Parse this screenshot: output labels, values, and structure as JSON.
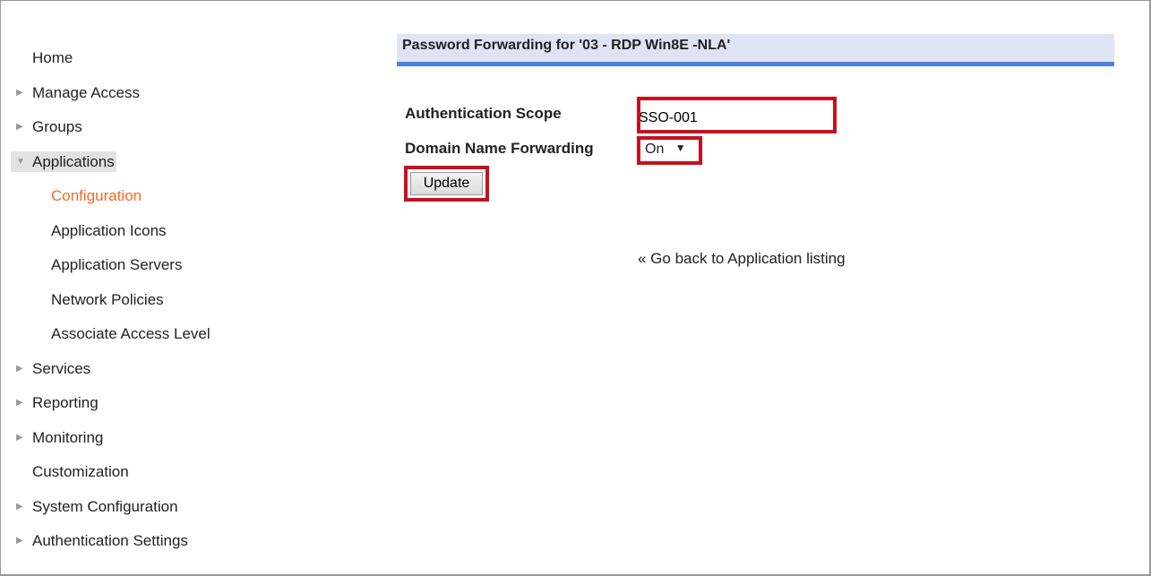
{
  "sidebar": {
    "items": [
      {
        "label": "Home",
        "arrow": ""
      },
      {
        "label": "Manage Access",
        "arrow": "▶"
      },
      {
        "label": "Groups",
        "arrow": "▶"
      },
      {
        "label": "Applications",
        "arrow": "▼"
      },
      {
        "label": "Configuration",
        "arrow": ""
      },
      {
        "label": "Application Icons",
        "arrow": ""
      },
      {
        "label": "Application Servers",
        "arrow": ""
      },
      {
        "label": "Network Policies",
        "arrow": ""
      },
      {
        "label": "Associate Access Level",
        "arrow": ""
      },
      {
        "label": "Services",
        "arrow": "▶"
      },
      {
        "label": "Reporting",
        "arrow": "▶"
      },
      {
        "label": "Monitoring",
        "arrow": "▶"
      },
      {
        "label": "Customization",
        "arrow": ""
      },
      {
        "label": "System Configuration",
        "arrow": "▶"
      },
      {
        "label": "Authentication Settings",
        "arrow": "▶"
      }
    ]
  },
  "main": {
    "title": "Password Forwarding for '03 - RDP Win8E -NLA'",
    "auth_scope_label": "Authentication Scope",
    "auth_scope_value": "SSO-001",
    "domain_fwd_label": "Domain Name Forwarding",
    "domain_fwd_value": "On",
    "dropdown_arrow": "▼",
    "update_label": "Update",
    "back_link": "« Go back to Application listing"
  },
  "colors": {
    "accent": "#f26b2b",
    "highlight": "#c8101e",
    "header_bar": "#4a7fe0"
  }
}
